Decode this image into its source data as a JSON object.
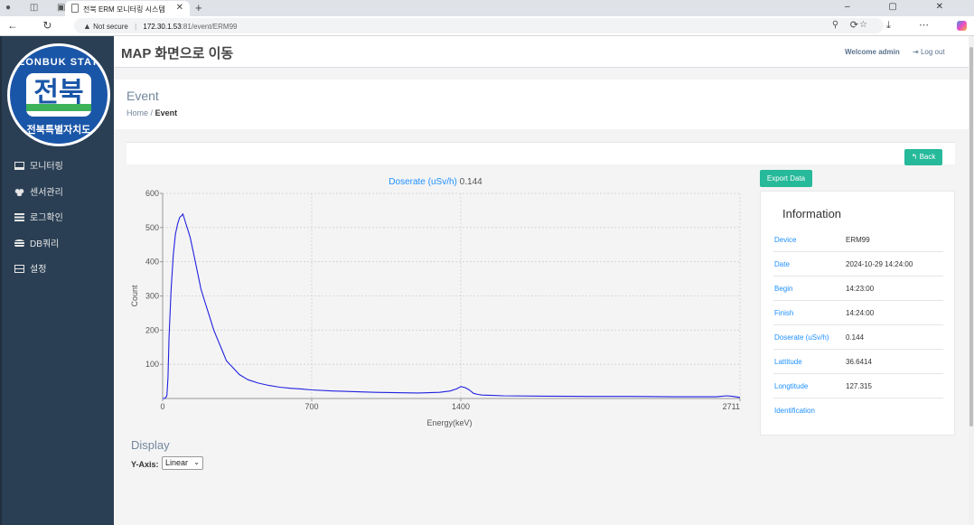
{
  "browser": {
    "tab_title": "전북 ERM 모니터링 시스템",
    "security_label": "Not secure",
    "url_host": "172.30.1.53",
    "url_path": ":81/event/ERM99"
  },
  "sidebar": {
    "logo": {
      "top_text": "JEONBUK STATE",
      "main_text": "전북",
      "bottom_text": "전북특별자치도"
    },
    "menu": [
      {
        "label": "모니터링",
        "icon": "monitor-icon"
      },
      {
        "label": "센서관리",
        "icon": "cubes-icon"
      },
      {
        "label": "로그확인",
        "icon": "list-icon"
      },
      {
        "label": "DB쿼리",
        "icon": "database-icon"
      },
      {
        "label": "설정",
        "icon": "settings-icon"
      }
    ]
  },
  "topnav": {
    "map_link": "MAP 화면으로 이동",
    "welcome": "Welcome admin",
    "logout": "Log out"
  },
  "page": {
    "title": "Event",
    "breadcrumb": {
      "home": "Home",
      "separator": "/",
      "current": "Event"
    }
  },
  "buttons": {
    "back": "Back",
    "export": "Export Data"
  },
  "chart_data": {
    "type": "line",
    "title": "Doserate (uSv/h)",
    "title_value": "0.144",
    "xlabel": "Energy(keV)",
    "ylabel": "Count",
    "xlim": [
      0,
      2711
    ],
    "ylim": [
      0,
      600
    ],
    "xticks": [
      0,
      700,
      1400,
      2711
    ],
    "yticks": [
      100,
      200,
      300,
      400,
      500,
      600
    ],
    "grid": true,
    "color": "#2020e0",
    "series": [
      {
        "x": [
          0,
          10,
          20,
          25,
          30,
          40,
          50,
          60,
          70,
          80,
          90,
          95,
          100,
          110,
          120,
          130,
          140,
          150,
          160,
          170,
          180,
          200,
          220,
          240,
          260,
          280,
          300,
          330,
          360,
          400,
          450,
          500,
          550,
          600,
          650,
          700,
          800,
          900,
          1000,
          1100,
          1200,
          1300,
          1350,
          1380,
          1400,
          1420,
          1440,
          1460,
          1480,
          1500,
          1550,
          1600,
          1800,
          2000,
          2200,
          2400,
          2600,
          2650,
          2680,
          2711
        ],
        "y": [
          0,
          0,
          8,
          60,
          180,
          320,
          420,
          480,
          510,
          530,
          535,
          540,
          530,
          510,
          490,
          470,
          440,
          410,
          380,
          350,
          320,
          280,
          240,
          200,
          170,
          140,
          110,
          90,
          70,
          55,
          45,
          38,
          33,
          30,
          28,
          25,
          22,
          20,
          18,
          17,
          16,
          18,
          22,
          28,
          35,
          32,
          25,
          15,
          12,
          10,
          9,
          8,
          7,
          6,
          6,
          5,
          5,
          8,
          6,
          3
        ]
      }
    ]
  },
  "info": {
    "title": "Information",
    "rows": [
      {
        "key": "Device",
        "value": "ERM99"
      },
      {
        "key": "Date",
        "value": "2024-10-29 14:24:00"
      },
      {
        "key": "Begin",
        "value": "14:23:00"
      },
      {
        "key": "Finish",
        "value": "14:24:00"
      },
      {
        "key": "Doserate (uSv/h)",
        "value": "0.144"
      },
      {
        "key": "Lattitude",
        "value": "36.6414"
      },
      {
        "key": "Longtitude",
        "value": "127.315"
      },
      {
        "key": "Identification",
        "value": ""
      }
    ]
  },
  "display": {
    "title": "Display",
    "yaxis_label": "Y-Axis:",
    "yaxis_selected": "Linear"
  },
  "colors": {
    "sidebar": "#2a3f54",
    "accent": "#26b99a",
    "link": "#1e90ff",
    "series": "#2020e0"
  }
}
